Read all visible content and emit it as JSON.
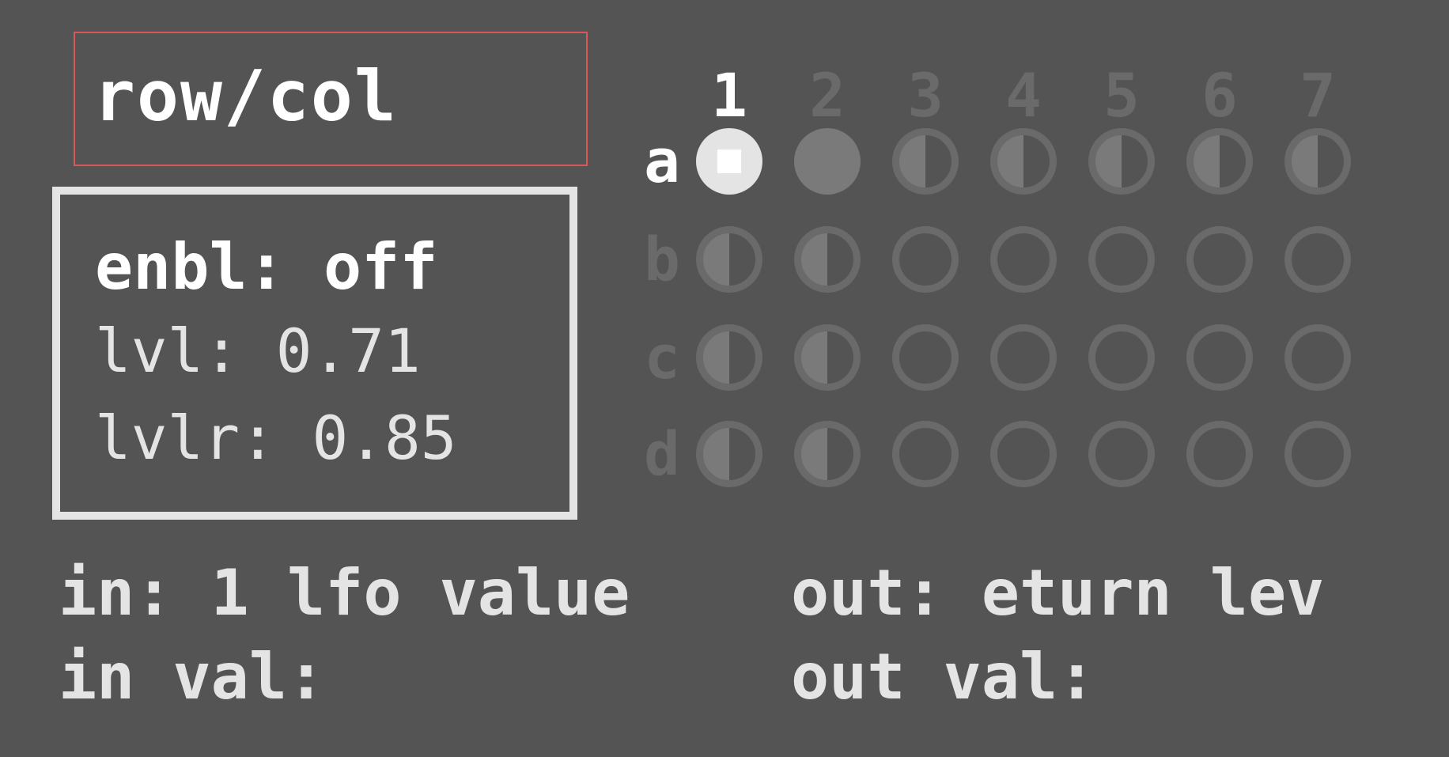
{
  "header": {
    "title": "row/col"
  },
  "info": {
    "enbl": "enbl: off",
    "lvl": "lvl: 0.71",
    "lvlr": "lvlr: 0.85"
  },
  "grid": {
    "columns": [
      "1",
      "2",
      "3",
      "4",
      "5",
      "6",
      "7"
    ],
    "active_column": "1",
    "rows": [
      {
        "label": "a",
        "active": true,
        "cells": [
          "active",
          "filled",
          "half",
          "half",
          "half",
          "half",
          "half"
        ]
      },
      {
        "label": "b",
        "active": false,
        "cells": [
          "half",
          "half",
          "empty",
          "empty",
          "empty",
          "empty",
          "empty"
        ]
      },
      {
        "label": "c",
        "active": false,
        "cells": [
          "half",
          "half",
          "empty",
          "empty",
          "empty",
          "empty",
          "empty"
        ]
      },
      {
        "label": "d",
        "active": false,
        "cells": [
          "half",
          "half",
          "empty",
          "empty",
          "empty",
          "empty",
          "empty"
        ]
      }
    ]
  },
  "io": {
    "in_label": "in: 1 lfo value",
    "in_val": "in val:",
    "out_label": "out: eturn lev",
    "out_val": "out val:"
  },
  "colors": {
    "background": "#545454",
    "active_text": "#ffffff",
    "inactive_text": "#6a6a6a",
    "accent_border": "#d9585a",
    "box_border": "#e4e4e4"
  }
}
